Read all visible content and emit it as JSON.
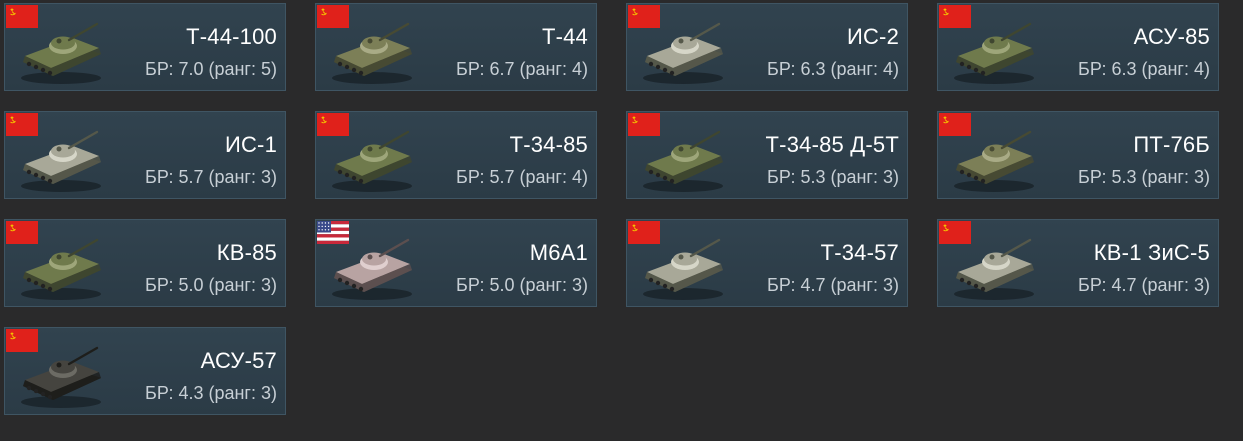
{
  "vehicles": [
    {
      "name": "Т-44-100",
      "br": "БР: 7.0 (ранг: 5)",
      "nation": "ussr",
      "camo": "green"
    },
    {
      "name": "Т-44",
      "br": "БР: 6.7 (ранг: 4)",
      "nation": "ussr",
      "camo": "olive"
    },
    {
      "name": "ИС-2",
      "br": "БР: 6.3 (ранг: 4)",
      "nation": "ussr",
      "camo": "winter"
    },
    {
      "name": "АСУ-85",
      "br": "БР: 6.3 (ранг: 4)",
      "nation": "ussr",
      "camo": "green"
    },
    {
      "name": "ИС-1",
      "br": "БР: 5.7 (ранг: 3)",
      "nation": "ussr",
      "camo": "winter"
    },
    {
      "name": "Т-34-85",
      "br": "БР: 5.7 (ранг: 4)",
      "nation": "ussr",
      "camo": "green"
    },
    {
      "name": "Т-34-85 Д-5Т",
      "br": "БР: 5.3 (ранг: 3)",
      "nation": "ussr",
      "camo": "green"
    },
    {
      "name": "ПТ-76Б",
      "br": "БР: 5.3 (ранг: 3)",
      "nation": "ussr",
      "camo": "olive"
    },
    {
      "name": "КВ-85",
      "br": "БР: 5.0 (ранг: 3)",
      "nation": "ussr",
      "camo": "green"
    },
    {
      "name": "M6A1",
      "br": "БР: 5.0 (ранг: 3)",
      "nation": "usa",
      "camo": "pink"
    },
    {
      "name": "Т-34-57",
      "br": "БР: 4.7 (ранг: 3)",
      "nation": "ussr",
      "camo": "winter"
    },
    {
      "name": "КВ-1 ЗиС-5",
      "br": "БР: 4.7 (ранг: 3)",
      "nation": "ussr",
      "camo": "winter"
    },
    {
      "name": "АСУ-57",
      "br": "БР: 4.3 (ранг: 3)",
      "nation": "ussr",
      "camo": "dark"
    }
  ],
  "colors": {
    "background": "#2a2a2b",
    "card": "#31434f",
    "card_border": "#3f5563",
    "name_text": "#ffffff",
    "br_text": "#c7cfd5",
    "ussr_flag": "#e0211b",
    "usa_red": "#c8283a",
    "usa_blue": "#3a4a8a"
  }
}
